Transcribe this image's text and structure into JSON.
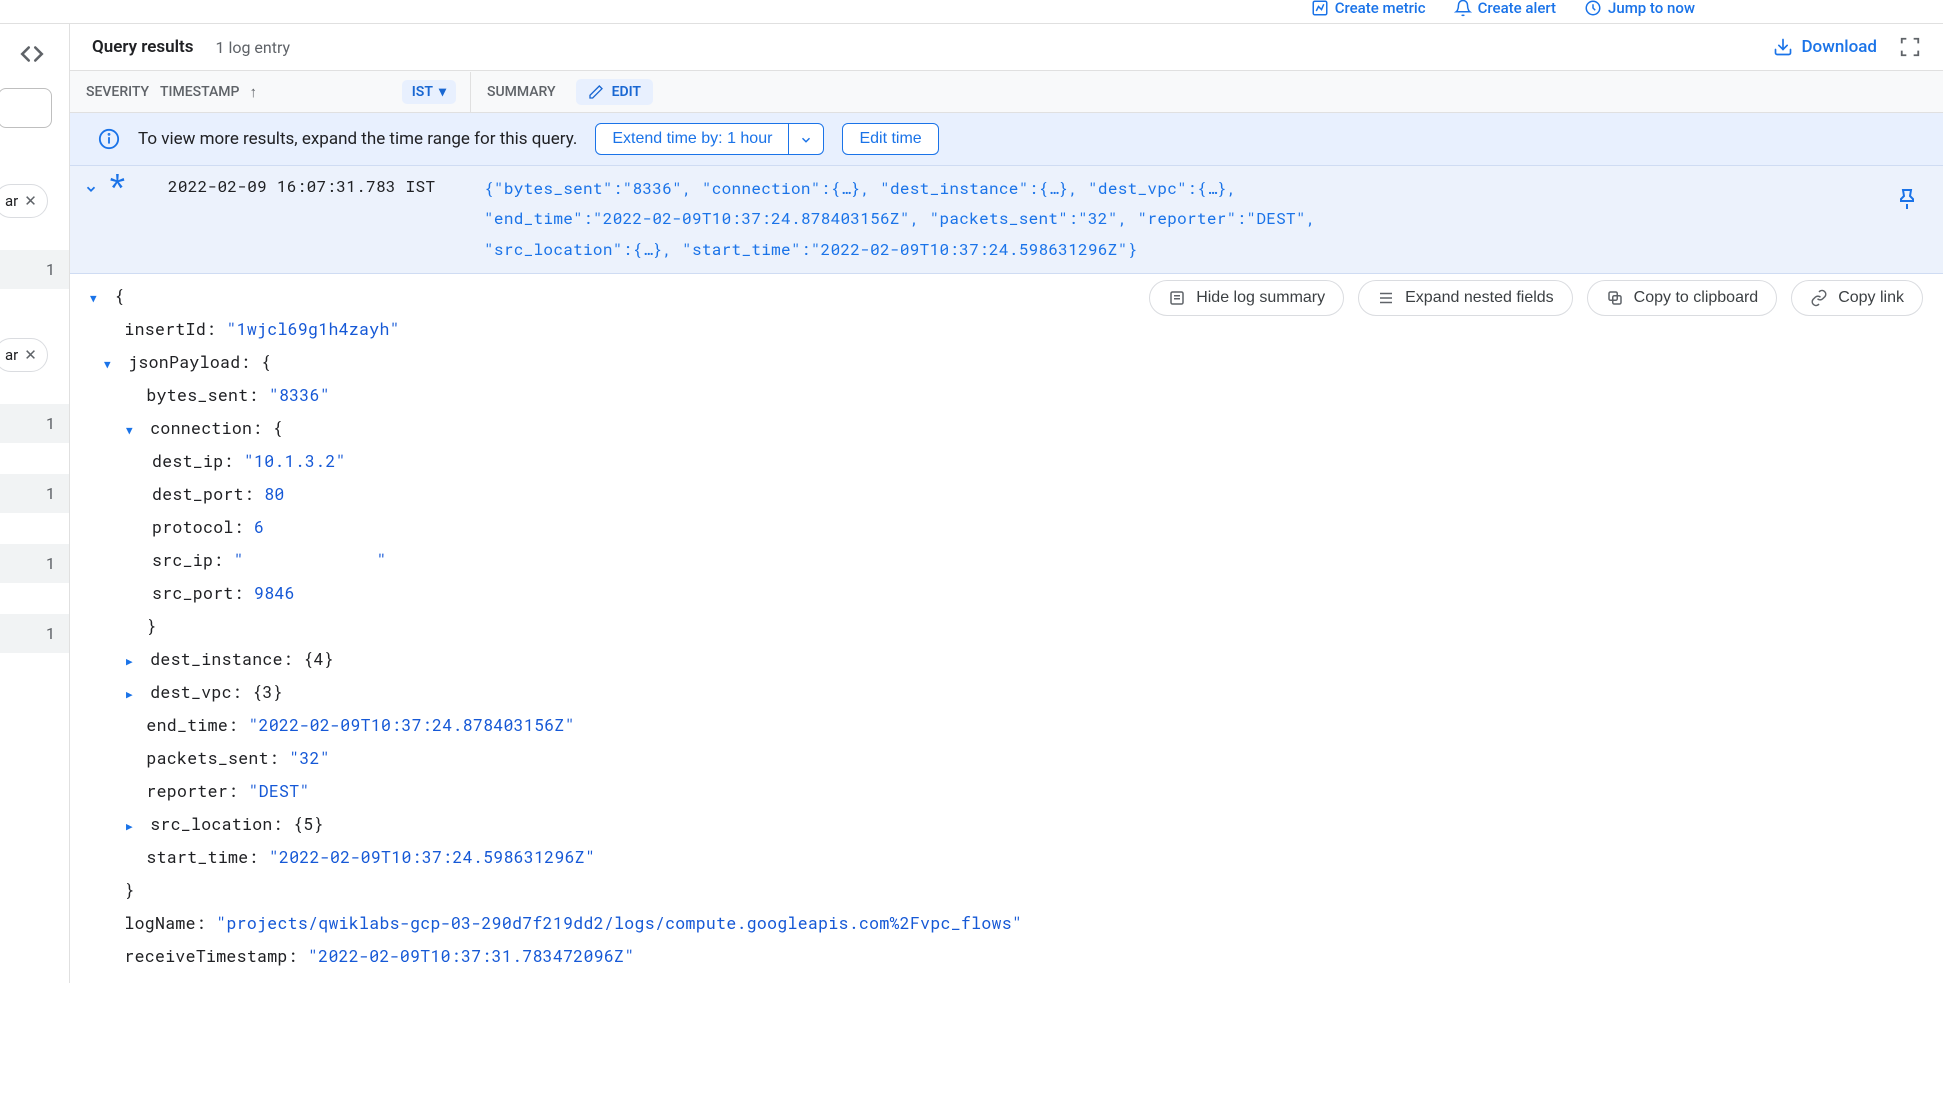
{
  "topbar": {
    "create_metric": "Create metric",
    "create_alert": "Create alert",
    "jump_to_now": "Jump to now"
  },
  "header": {
    "title": "Query results",
    "entry_count": "1 log entry",
    "download": "Download"
  },
  "columns": {
    "severity": "SEVERITY",
    "timestamp": "TIMESTAMP",
    "timezone": "IST",
    "summary": "SUMMARY",
    "edit": "EDIT"
  },
  "banner": {
    "message": "To view more results, expand the time range for this query.",
    "extend_label": "Extend time by: 1 hour",
    "edit_time": "Edit time"
  },
  "actions": {
    "hide_summary": "Hide log summary",
    "expand_nested": "Expand nested fields",
    "copy_clipboard": "Copy to clipboard",
    "copy_link": "Copy link"
  },
  "side": {
    "chip1": "ar",
    "chip2": "ar",
    "counts": [
      "1",
      "1",
      "1",
      "1",
      "1"
    ]
  },
  "log": {
    "timestamp": "2022-02-09 16:07:31.783 IST",
    "summary_line1": "{\"bytes_sent\":\"8336\", \"connection\":{…}, \"dest_instance\":{…}, \"dest_vpc\":{…},",
    "summary_line2": "\"end_time\":\"2022-02-09T10:37:24.878403156Z\", \"packets_sent\":\"32\", \"reporter\":\"DEST\",",
    "summary_line3": "\"src_location\":{…}, \"start_time\":\"2022-02-09T10:37:24.598631296Z\"}",
    "insertId": "1wjcl69g1h4zayh",
    "jsonPayload": {
      "bytes_sent": "8336",
      "connection": {
        "dest_ip": "10.1.3.2",
        "dest_port": 80,
        "protocol": 6,
        "src_ip": " ",
        "src_port": 9846
      },
      "dest_instance_count": 4,
      "dest_vpc_count": 3,
      "end_time": "2022-02-09T10:37:24.878403156Z",
      "packets_sent": "32",
      "reporter": "DEST",
      "src_location_count": 5,
      "start_time": "2022-02-09T10:37:24.598631296Z"
    },
    "logName": "projects/qwiklabs-gcp-03-290d7f219dd2/logs/compute.googleapis.com%2Fvpc_flows",
    "receiveTimestamp": "2022-02-09T10:37:31.783472096Z"
  }
}
